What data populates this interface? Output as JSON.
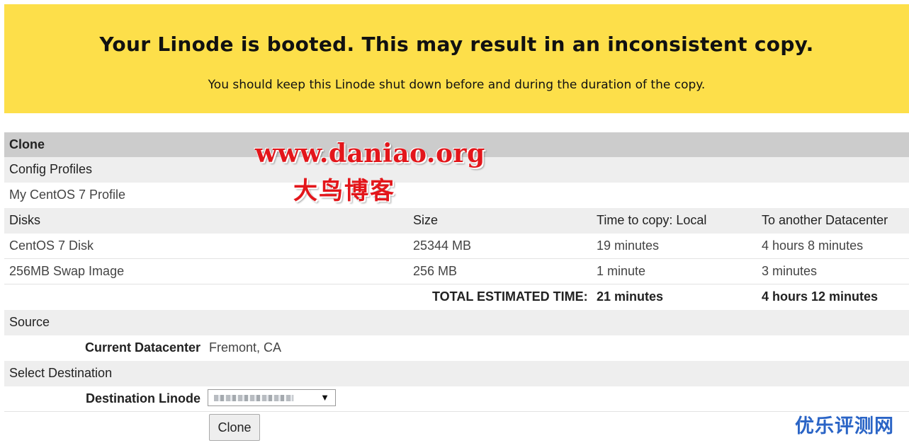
{
  "banner": {
    "title": "Your Linode is booted. This may result in an inconsistent copy.",
    "subtitle": "You should keep this Linode shut down before and during the duration of the copy.",
    "background_color": "#fddf4a"
  },
  "clone": {
    "header": "Clone",
    "config_profiles": {
      "label": "Config Profiles",
      "items": [
        "My CentOS 7 Profile"
      ]
    },
    "disks": {
      "columns": [
        "Disks",
        "Size",
        "Time to copy: Local",
        "To another Datacenter"
      ],
      "rows": [
        {
          "name": "CentOS 7 Disk",
          "size": "25344 MB",
          "local": "19 minutes",
          "remote": "4 hours 8 minutes"
        },
        {
          "name": "256MB Swap Image",
          "size": "256 MB",
          "local": "1 minute",
          "remote": "3 minutes"
        }
      ],
      "total_label": "TOTAL ESTIMATED TIME:",
      "total_local": "21 minutes",
      "total_remote": "4 hours 12 minutes"
    },
    "source": {
      "label": "Source",
      "current_datacenter_label": "Current Datacenter",
      "current_datacenter_value": "Fremont, CA"
    },
    "destination": {
      "label": "Select Destination",
      "linode_label": "Destination Linode",
      "linode_value_obscured": true
    },
    "button_label": "Clone"
  },
  "watermarks": {
    "url": "www.daniao.org",
    "cn_name": "大鸟博客",
    "corner": "优乐评测网"
  },
  "colors": {
    "header_gray": "#cccccc",
    "row_gray": "#eeeeee",
    "watermark_red": "#e3161b",
    "watermark_blue": "#2a64c6"
  }
}
